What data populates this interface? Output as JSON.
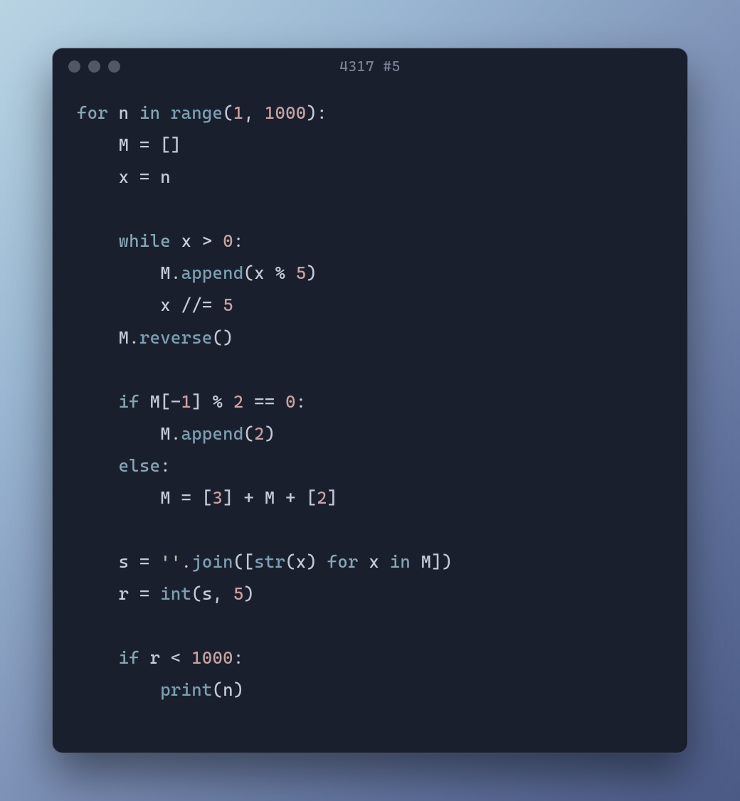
{
  "window": {
    "title": "4317 #5"
  },
  "code": {
    "line1": {
      "kw_for": "for",
      "var_n": "n",
      "kw_in": "in",
      "fn_range": "range",
      "p1": "(",
      "n1": "1",
      "comma": ", ",
      "n1000": "1000",
      "p2": "):"
    },
    "line2": {
      "indent": "    ",
      "var_M": "M",
      "eq": " = ",
      "brackets": "[]"
    },
    "line3": {
      "indent": "    ",
      "var_x": "x",
      "eq": " = ",
      "var_n": "n"
    },
    "line4": "",
    "line5": {
      "indent": "    ",
      "kw_while": "while",
      "sp": " ",
      "var_x": "x",
      "gt": " > ",
      "n0": "0",
      "colon": ":"
    },
    "line6": {
      "indent": "        ",
      "var_M": "M",
      "dot": ".",
      "fn_append": "append",
      "p1": "(",
      "var_x": "x",
      "mod": " % ",
      "n5": "5",
      "p2": ")"
    },
    "line7": {
      "indent": "        ",
      "var_x": "x",
      "fdiv": " //= ",
      "n5": "5"
    },
    "line8": {
      "indent": "    ",
      "var_M": "M",
      "dot": ".",
      "fn_reverse": "reverse",
      "parens": "()"
    },
    "line9": "",
    "line10": {
      "indent": "    ",
      "kw_if": "if",
      "sp": " ",
      "var_M": "M",
      "idx": "[-",
      "n1": "1",
      "idx2": "]",
      "mod": " % ",
      "n2": "2",
      "eqeq": " == ",
      "n0": "0",
      "colon": ":"
    },
    "line11": {
      "indent": "        ",
      "var_M": "M",
      "dot": ".",
      "fn_append": "append",
      "p1": "(",
      "n2": "2",
      "p2": ")"
    },
    "line12": {
      "indent": "    ",
      "kw_else": "else",
      "colon": ":"
    },
    "line13": {
      "indent": "        ",
      "var_M": "M",
      "eq": " = ",
      "b1": "[",
      "n3": "3",
      "b2": "]",
      "plus1": " + ",
      "var_M2": "M",
      "plus2": " + ",
      "b3": "[",
      "n2": "2",
      "b4": "]"
    },
    "line14": "",
    "line15": {
      "indent": "    ",
      "var_s": "s",
      "eq": " = ",
      "str_empty": "''",
      "dot": ".",
      "fn_join": "join",
      "p1": "([",
      "fn_str": "str",
      "p2": "(",
      "var_x": "x",
      "p3": ")",
      "sp1": " ",
      "kw_for": "for",
      "sp2": " ",
      "var_x2": "x",
      "sp3": " ",
      "kw_in": "in",
      "sp4": " ",
      "var_M": "M",
      "p4": "])"
    },
    "line16": {
      "indent": "    ",
      "var_r": "r",
      "eq": " = ",
      "fn_int": "int",
      "p1": "(",
      "var_s": "s",
      "comma": ", ",
      "n5": "5",
      "p2": ")"
    },
    "line17": "",
    "line18": {
      "indent": "    ",
      "kw_if": "if",
      "sp": " ",
      "var_r": "r",
      "lt": " < ",
      "n1000": "1000",
      "colon": ":"
    },
    "line19": {
      "indent": "        ",
      "fn_print": "print",
      "p1": "(",
      "var_n": "n",
      "p2": ")"
    }
  }
}
